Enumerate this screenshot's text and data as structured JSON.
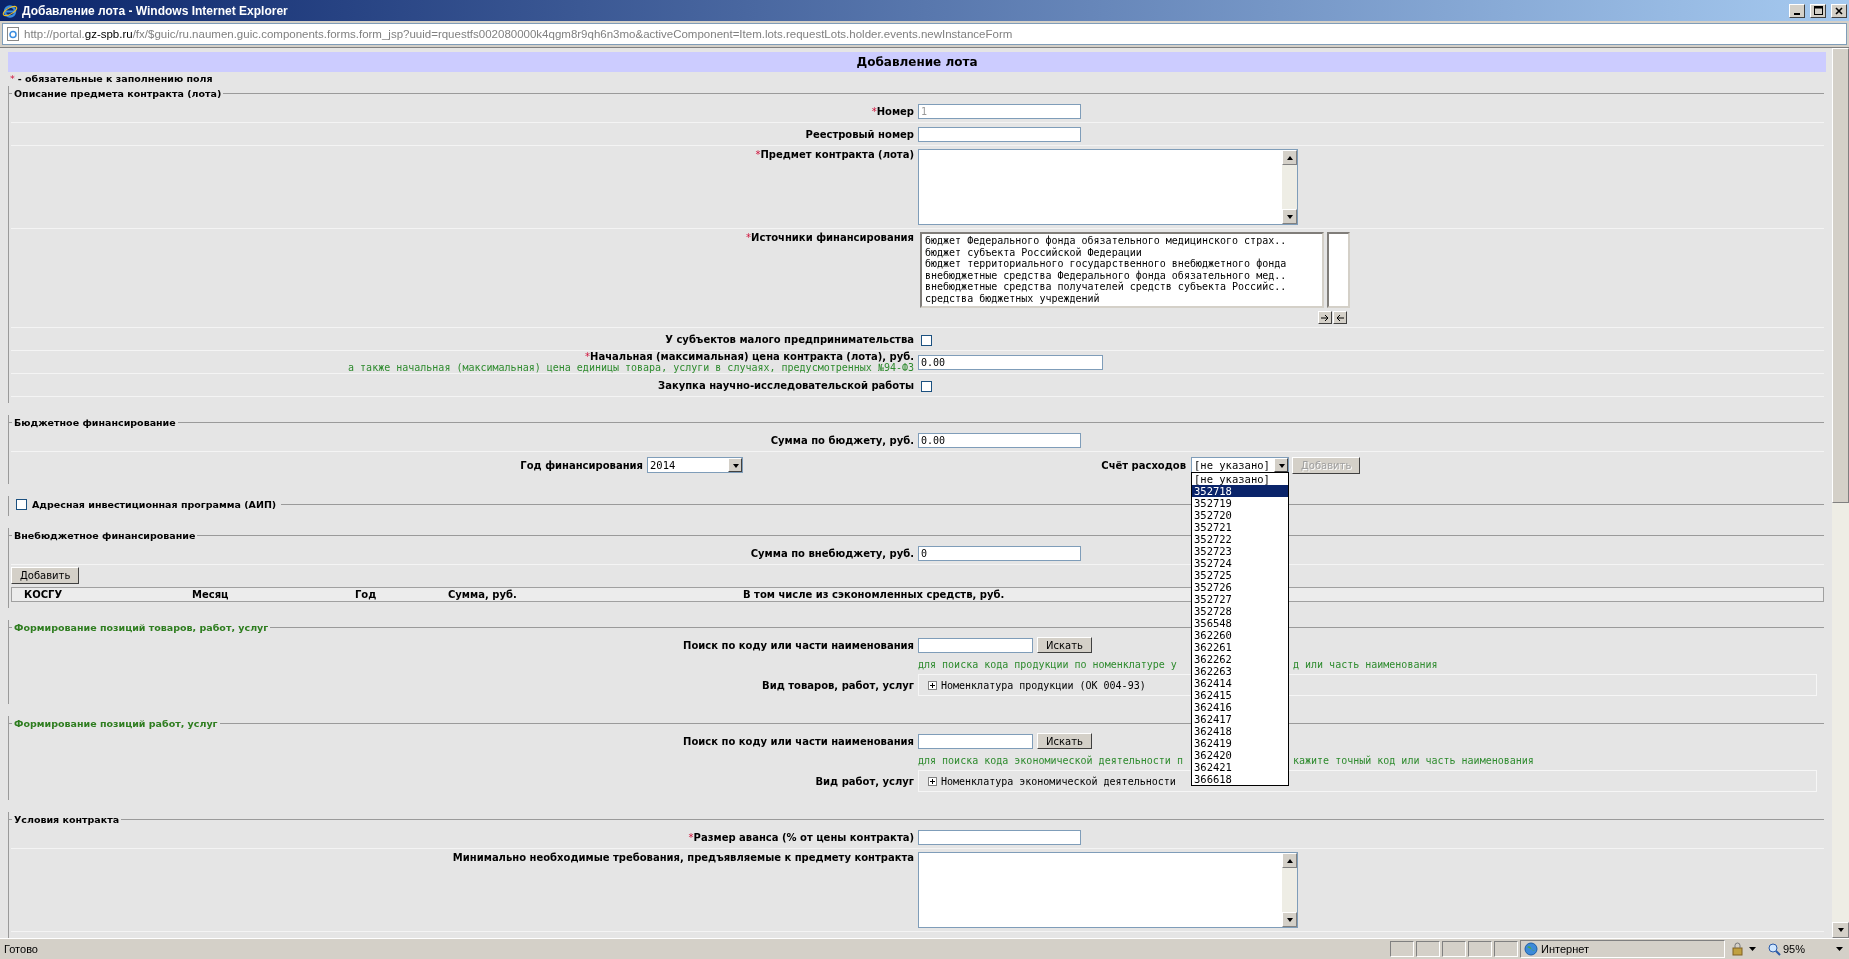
{
  "window": {
    "title": "Добавление лота - Windows Internet Explorer"
  },
  "address_bar": {
    "url_start": "http://portal.",
    "url_domain": "gz-spb.ru",
    "url_end": "/fx/$guic/ru.naumen.guic.components.forms.form_jsp?uuid=rquestfs002080000k4qgm8r9qh6n3mo&activeComponent=Item.lots.requestLots.holder.events.newInstanceForm"
  },
  "form": {
    "title": "Добавление лота",
    "required_mark": "*",
    "required_note": "- обязательные к заполнению поля"
  },
  "sections": [
    {
      "kind": "fields",
      "legend": "Описание предмета контракта (лота)",
      "rows": [
        {
          "kind": "input",
          "mark": "*",
          "label": "Номер",
          "value": "1",
          "disabled": true
        },
        {
          "kind": "input",
          "label": "Реестровый номер"
        },
        {
          "kind": "textarea",
          "mark": "*",
          "label": "Предмет контракта (лота)"
        },
        {
          "kind": "listbox",
          "mark": "*",
          "label": "Источники финансирования",
          "options": [
            "бюджет Федерального фонда обязательного медицинского страх..",
            "бюджет субъекта Российской Федерации",
            "бюджет территориального государственного внебюджетного фонда",
            "внебюджетные средства Федерального фонда обязательного мед..",
            "внебюджетные средства получателей средств субъекта Российс..",
            "средства бюджетных учреждений"
          ]
        },
        {
          "kind": "checkbox",
          "label": "У субъектов малого предпринимательства",
          "checked": false
        },
        {
          "kind": "input",
          "mark": "*",
          "label": "Начальная (максимальная) цена контракта (лота), руб.",
          "note": "а также начальная (максимальная) цена единицы товара, услуги в случаях, предусмотренных №94-ФЗ",
          "value": "0.00"
        },
        {
          "kind": "checkbox",
          "label": "Закупка научно-исследовательской работы",
          "checked": false
        }
      ]
    },
    {
      "kind": "fields",
      "legend": "Бюджетное финансирование",
      "rows": [
        {
          "kind": "input",
          "label": "Сумма по бюджету, руб.",
          "value": "0.00"
        },
        {
          "kind": "year_account",
          "year_label": "Год финансирования",
          "year_value": "2014",
          "account_label": "Счёт расходов",
          "account_value": "[не указано]",
          "account_open": true,
          "add_button": "Добавить",
          "add_disabled": true,
          "options": [
            {
              "label": "[не указано]",
              "selected": false
            },
            {
              "label": "352718",
              "selected": true
            },
            {
              "label": "352719",
              "selected": false
            },
            {
              "label": "352720",
              "selected": false
            },
            {
              "label": "352721",
              "selected": false
            },
            {
              "label": "352722",
              "selected": false
            },
            {
              "label": "352723",
              "selected": false
            },
            {
              "label": "352724",
              "selected": false
            },
            {
              "label": "352725",
              "selected": false
            },
            {
              "label": "352726",
              "selected": false
            },
            {
              "label": "352727",
              "selected": false
            },
            {
              "label": "352728",
              "selected": false
            },
            {
              "label": "356548",
              "selected": false
            },
            {
              "label": "362260",
              "selected": false
            },
            {
              "label": "362261",
              "selected": false
            },
            {
              "label": "362262",
              "selected": false
            },
            {
              "label": "362263",
              "selected": false
            },
            {
              "label": "362414",
              "selected": false
            },
            {
              "label": "362415",
              "selected": false
            },
            {
              "label": "362416",
              "selected": false
            },
            {
              "label": "362417",
              "selected": false
            },
            {
              "label": "362418",
              "selected": false
            },
            {
              "label": "362419",
              "selected": false
            },
            {
              "label": "362420",
              "selected": false
            },
            {
              "label": "362421",
              "selected": false
            },
            {
              "label": "366618",
              "selected": false
            }
          ]
        }
      ]
    },
    {
      "kind": "toggle",
      "legend": "Адресная инвестиционная программа (АИП)",
      "checked": false
    },
    {
      "kind": "fields",
      "legend": "Внебюджетное финансирование",
      "rows": [
        {
          "kind": "input",
          "label": "Сумма по внебюджету, руб.",
          "value": "0"
        },
        {
          "kind": "button",
          "label": "Добавить"
        },
        {
          "kind": "table_header",
          "columns": [
            "КОСГУ",
            "Месяц",
            "Год",
            "Сумма, руб.",
            "В том числе из сэкономленных средств, руб."
          ]
        }
      ]
    },
    {
      "kind": "positions",
      "legend": "Формирование позиций товаров, работ, услуг",
      "rows": [
        {
          "kind": "search",
          "label": "Поиск по коду или части наименования",
          "button": "Искать"
        },
        {
          "kind": "hint",
          "text_before": "для поиска кода продукции по номенклатуре у",
          "text_after": "д или часть наименования"
        },
        {
          "kind": "tree",
          "label": "Вид товаров, работ, услуг",
          "node": "Номенклатура продукции (ОК 004-93)",
          "expanded": false
        }
      ]
    },
    {
      "kind": "positions",
      "legend": "Формирование позиций работ, услуг",
      "rows": [
        {
          "kind": "search",
          "label": "Поиск по коду или части наименования",
          "button": "Искать"
        },
        {
          "kind": "hint",
          "text_before": "для поиска кода экономической деятельности п",
          "text_after": "кажите точный код или часть наименования"
        },
        {
          "kind": "tree",
          "label": "Вид работ, услуг",
          "node": "Номенклатура экономической деятельности",
          "expanded": false
        }
      ]
    },
    {
      "kind": "fields",
      "legend": "Условия контракта",
      "rows": [
        {
          "kind": "input",
          "mark": "*",
          "label": "Размер аванса (% от цены контракта)"
        },
        {
          "kind": "textarea",
          "label": "Минимально необходимые требования, предъявляемые к предмету контракта"
        }
      ]
    }
  ],
  "status_bar": {
    "text": "Готово",
    "zone": "Интернет",
    "zoom": "95%"
  }
}
